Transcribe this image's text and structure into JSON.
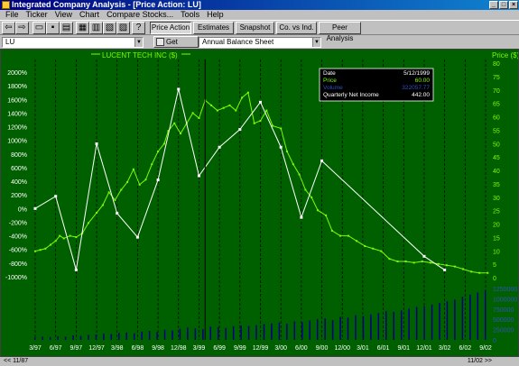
{
  "window": {
    "title": "Integrated Company Analysis - [Price Action:  LU]"
  },
  "menu": [
    "File",
    "Ticker",
    "View",
    "Chart",
    "Compare Stocks...",
    "Tools",
    "Help"
  ],
  "tabs": [
    "Price Action",
    "Estimates",
    "Snapshot",
    "Co. vs Ind.",
    "Peer Analysis"
  ],
  "toolbar2": {
    "ticker": "LU",
    "get_report": "Get Report",
    "report_type": "Annual Balance Sheet"
  },
  "tooltip": {
    "rows": [
      {
        "label": "Date",
        "value": "5/12/1999"
      },
      {
        "label": "Price",
        "value": "60.00"
      },
      {
        "label": "Volume",
        "value": "322057.77"
      },
      {
        "label": "Quarterly Net Income",
        "value": "442.00"
      }
    ]
  },
  "nav": {
    "left": "<< 11/87",
    "right": "11/02 >>"
  },
  "colors": {
    "background": "#006000",
    "price": "#7cfc00",
    "income": "#ffffff",
    "volume": "#000080"
  },
  "chart_data": {
    "type": "line",
    "title": "",
    "legend": "LUCENT TECH INC ($)",
    "left_axis_label": "",
    "right_axis_label": "Price ($)",
    "left_ticks": [
      "2000%",
      "1800%",
      "1600%",
      "1400%",
      "1200%",
      "1000%",
      "800%",
      "600%",
      "400%",
      "200%",
      "0%",
      "-200%",
      "-400%",
      "-600%",
      "-800%",
      "-1000%"
    ],
    "right_ticks": [
      "80",
      "75",
      "70",
      "65",
      "60",
      "55",
      "50",
      "45",
      "40",
      "35",
      "30",
      "25",
      "20",
      "15",
      "10",
      "5",
      "0"
    ],
    "volume_ticks": [
      "1250000",
      "1000000",
      "750000",
      "500000",
      "250000",
      "0"
    ],
    "x_ticks": [
      "3/97",
      "6/97",
      "9/97",
      "12/97",
      "3/98",
      "6/98",
      "9/98",
      "12/98",
      "3/99",
      "6/99",
      "9/99",
      "12/99",
      "3/00",
      "6/00",
      "9/00",
      "12/00",
      "3/01",
      "6/01",
      "9/01",
      "12/01",
      "3/02",
      "6/02",
      "9/02"
    ],
    "ylim_percent": [
      -1000,
      2000
    ],
    "ylim_price": [
      0,
      80
    ],
    "series": [
      {
        "name": "LUCENT TECH INC ($)",
        "values": [
          [
            0,
            10
          ],
          [
            0.25,
            10.5
          ],
          [
            0.5,
            11
          ],
          [
            0.75,
            12.5
          ],
          [
            1,
            14
          ],
          [
            1.2,
            16
          ],
          [
            1.4,
            15
          ],
          [
            1.7,
            16
          ],
          [
            2,
            15.5
          ],
          [
            2.3,
            17
          ],
          [
            2.6,
            21
          ],
          [
            3,
            25
          ],
          [
            3.3,
            28
          ],
          [
            3.6,
            33
          ],
          [
            3.9,
            30
          ],
          [
            4.2,
            34
          ],
          [
            4.5,
            37
          ],
          [
            4.8,
            42
          ],
          [
            5.1,
            36
          ],
          [
            5.4,
            38
          ],
          [
            5.7,
            44
          ],
          [
            6,
            49
          ],
          [
            6.3,
            52
          ],
          [
            6.5,
            57
          ],
          [
            6.8,
            60
          ],
          [
            7.1,
            56
          ],
          [
            7.4,
            60
          ],
          [
            7.7,
            64
          ],
          [
            8,
            62
          ],
          [
            8.3,
            69
          ],
          [
            8.6,
            67
          ],
          [
            8.9,
            65
          ],
          [
            9.2,
            66
          ],
          [
            9.5,
            67
          ],
          [
            9.8,
            65
          ],
          [
            10.1,
            70
          ],
          [
            10.4,
            72
          ],
          [
            10.7,
            60
          ],
          [
            11,
            61
          ],
          [
            11.3,
            65
          ],
          [
            11.6,
            59
          ],
          [
            12,
            58
          ],
          [
            12.3,
            49
          ],
          [
            12.6,
            44
          ],
          [
            12.9,
            40
          ],
          [
            13.2,
            34
          ],
          [
            13.5,
            31
          ],
          [
            13.8,
            26
          ],
          [
            14.2,
            24
          ],
          [
            14.5,
            18
          ],
          [
            14.9,
            16
          ],
          [
            15.3,
            16
          ],
          [
            15.7,
            14
          ],
          [
            16.1,
            12
          ],
          [
            16.5,
            11
          ],
          [
            16.9,
            10
          ],
          [
            17.3,
            7
          ],
          [
            17.7,
            6
          ],
          [
            18.1,
            6
          ],
          [
            18.5,
            5.5
          ],
          [
            18.9,
            6
          ],
          [
            19.3,
            5.5
          ],
          [
            19.7,
            5
          ],
          [
            20.1,
            4.5
          ],
          [
            20.5,
            4
          ],
          [
            20.9,
            3
          ],
          [
            21.3,
            2
          ],
          [
            21.7,
            1.5
          ],
          [
            22.1,
            1.5
          ]
        ]
      },
      {
        "name": "Quarterly Net Income (%)",
        "values": [
          [
            0,
            0
          ],
          [
            1,
            180
          ],
          [
            2,
            -900
          ],
          [
            3,
            950
          ],
          [
            4,
            -70
          ],
          [
            5,
            -420
          ],
          [
            6,
            420
          ],
          [
            7,
            1750
          ],
          [
            8,
            480
          ],
          [
            9,
            900
          ],
          [
            10,
            1160
          ],
          [
            11,
            1560
          ],
          [
            12,
            900
          ],
          [
            13,
            -130
          ],
          [
            14,
            700
          ],
          [
            19,
            -700
          ],
          [
            20,
            -900
          ]
        ]
      },
      {
        "name": "Volume",
        "values": [
          60000,
          80000,
          70000,
          90000,
          75000,
          110000,
          95000,
          120000,
          130000,
          150000,
          140000,
          170000,
          180000,
          160000,
          200000,
          220000,
          190000,
          250000,
          230000,
          270000,
          300000,
          280000,
          260000,
          320000,
          310000,
          290000,
          330000,
          350000,
          340000,
          360000,
          380000,
          400000,
          420000,
          390000,
          450000,
          430000,
          470000,
          500000,
          520000,
          480000,
          560000,
          540000,
          600000,
          580000,
          620000,
          650000,
          700000,
          680000,
          720000,
          760000,
          800000,
          820000,
          860000,
          900000,
          940000,
          980000,
          1050000,
          1100000,
          1150000,
          1200000
        ]
      }
    ]
  }
}
